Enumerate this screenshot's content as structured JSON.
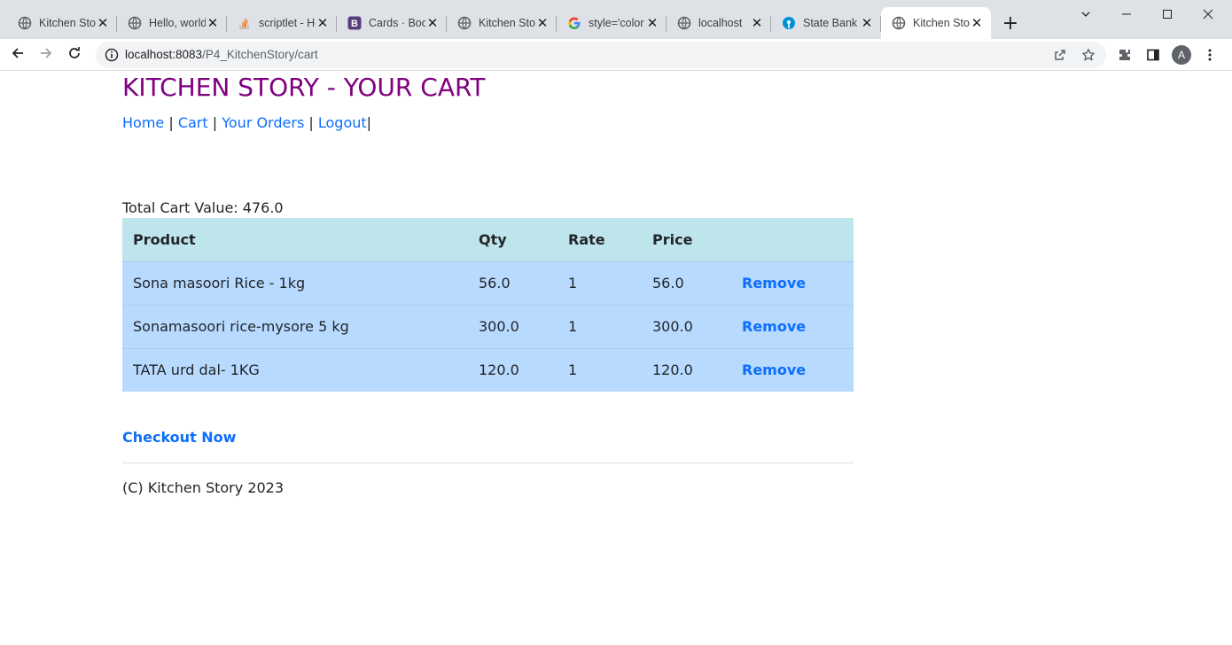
{
  "browser": {
    "tabs": [
      {
        "title": "Kitchen Story",
        "icon": "globe-icon"
      },
      {
        "title": "Hello, world!",
        "icon": "globe-icon"
      },
      {
        "title": "scriptlet - How",
        "icon": "stackoverflow-icon"
      },
      {
        "title": "Cards · Bootstrap",
        "icon": "bootstrap-icon"
      },
      {
        "title": "Kitchen Story",
        "icon": "globe-icon"
      },
      {
        "title": "style='color",
        "icon": "google-icon"
      },
      {
        "title": "localhost",
        "icon": "globe-icon"
      },
      {
        "title": "State Bank",
        "icon": "sbi-icon"
      },
      {
        "title": "Kitchen Story",
        "icon": "globe-icon",
        "active": true
      }
    ],
    "url_host": "localhost:8083",
    "url_path": "/P4_KitchenStory/cart",
    "avatar_letter": "A"
  },
  "page": {
    "title": "KITCHEN STORY - YOUR CART",
    "nav": {
      "home": "Home",
      "cart": "Cart",
      "orders": "Your Orders",
      "logout": "Logout",
      "sep": "|"
    },
    "total_label": "Total Cart Value: 476.0",
    "table": {
      "headers": [
        "Product",
        "Qty",
        "Rate",
        "Price",
        ""
      ],
      "rows": [
        {
          "product": "Sona masoori Rice - 1kg",
          "qty": "56.0",
          "rate": "1",
          "price": "56.0",
          "action": "Remove"
        },
        {
          "product": "Sonamasoori rice-mysore 5 kg",
          "qty": "300.0",
          "rate": "1",
          "price": "300.0",
          "action": "Remove"
        },
        {
          "product": "TATA urd dal- 1KG",
          "qty": "120.0",
          "rate": "1",
          "price": "120.0",
          "action": "Remove"
        }
      ]
    },
    "checkout": "Checkout Now",
    "footer": "(C) Kitchen Story 2023"
  },
  "colors": {
    "title": "#800080",
    "link": "#0d6efd",
    "table_header_bg": "#bee5eb",
    "table_row_bg": "#b8daff"
  }
}
